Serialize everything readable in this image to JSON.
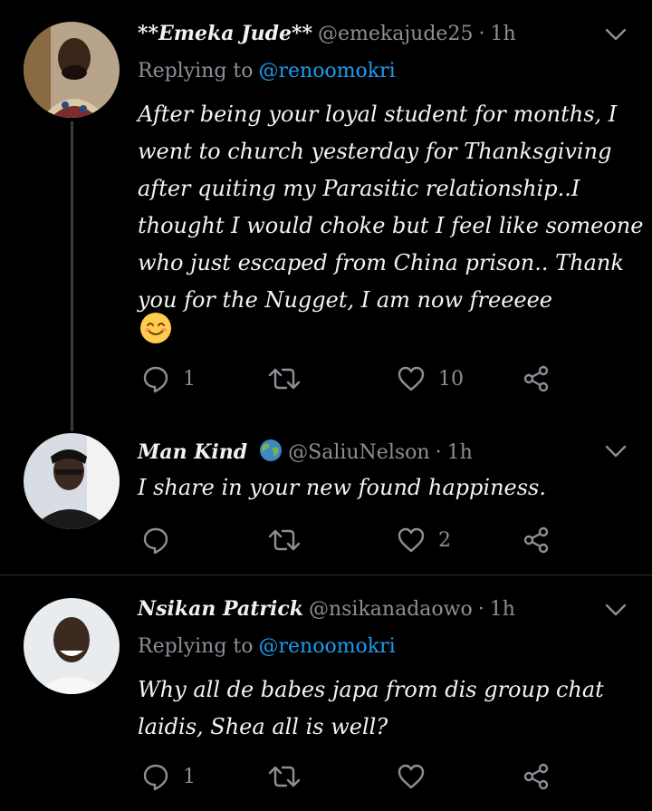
{
  "colors": {
    "background": "#000000",
    "text": "#e7e9ea",
    "muted": "#8b9096",
    "link": "#1d9bf0",
    "divider": "#2f3336"
  },
  "tweets": [
    {
      "display_name": "**Emeka Jude**",
      "handle": "@emekajude25",
      "dot": "·",
      "time": "1h",
      "replying_to_label": "Replying to",
      "replying_to": "@renoomokri",
      "text": "After being your loyal student for months, I\nwent to church yesterday for Thanksgiving\nafter quiting my Parasitic relationship..I\nthought I would choke but I feel like someone\nwho just escaped from China prison.. Thank\nyou for the Nugget, I am now freeeee",
      "emoji": "smiling-face-icon",
      "replies": "1",
      "retweets": "",
      "likes": "10"
    },
    {
      "display_name": "Man Kind",
      "name_icon": "globe-icon",
      "handle": "@SaliuNelson",
      "dot": "·",
      "time": "1h",
      "text": "I share in your new found happiness.",
      "replies": "",
      "retweets": "",
      "likes": "2"
    },
    {
      "display_name": "Nsikan Patrick",
      "handle": "@nsikanadaowo",
      "dot": "·",
      "time": "1h",
      "replying_to_label": "Replying to",
      "replying_to": "@renoomokri",
      "text": "Why all de babes japa from dis group chat\nlaidis, Shea all is well?",
      "replies": "1",
      "retweets": "",
      "likes": ""
    }
  ]
}
